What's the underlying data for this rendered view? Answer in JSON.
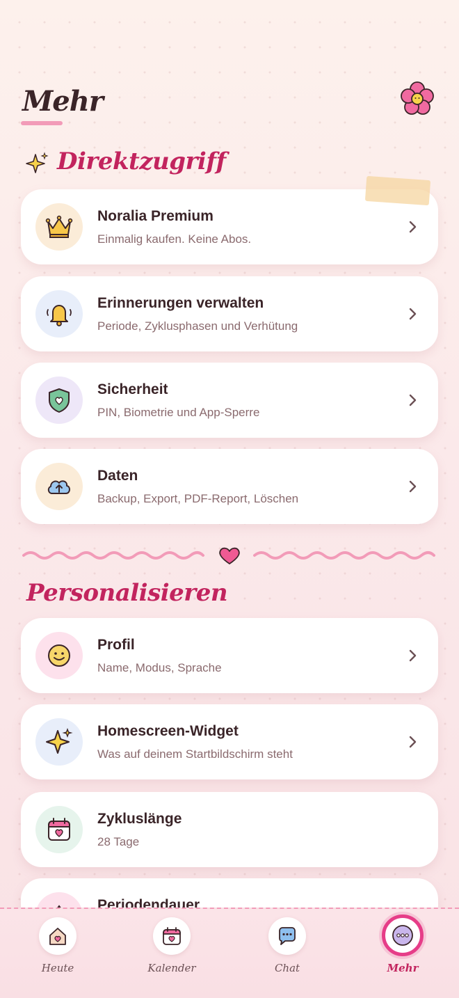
{
  "header": {
    "title": "Mehr"
  },
  "sections": {
    "quick_access": {
      "title": "Direktzugriff"
    },
    "personalize": {
      "title": "Personalisieren"
    }
  },
  "quick_items": [
    {
      "title": "Noralia Premium",
      "subtitle": "Einmalig kaufen. Keine Abos.",
      "icon": "crown-icon"
    },
    {
      "title": "Erinnerungen verwalten",
      "subtitle": "Periode, Zyklusphasen und Verhütung",
      "icon": "bell-icon"
    },
    {
      "title": "Sicherheit",
      "subtitle": "PIN, Biometrie und App-Sperre",
      "icon": "shield-heart-icon"
    },
    {
      "title": "Daten",
      "subtitle": "Backup, Export, PDF-Report, Löschen",
      "icon": "cloud-upload-icon"
    }
  ],
  "personal_items": [
    {
      "title": "Profil",
      "subtitle": "Name, Modus, Sprache",
      "icon": "smiley-icon"
    },
    {
      "title": "Homescreen-Widget",
      "subtitle": "Was auf deinem Startbildschirm steht",
      "icon": "sparkle-icon"
    },
    {
      "title": "Zykluslänge",
      "subtitle": "28 Tage",
      "icon": "calendar-heart-icon"
    },
    {
      "title": "Periodendauer",
      "subtitle": "",
      "icon": "drop-icon"
    }
  ],
  "tabs": [
    {
      "label": "Heute",
      "icon": "house-heart-icon",
      "active": false
    },
    {
      "label": "Kalender",
      "icon": "calendar-icon",
      "active": false
    },
    {
      "label": "Chat",
      "icon": "chat-bubble-icon",
      "active": false
    },
    {
      "label": "Mehr",
      "icon": "more-dots-icon",
      "active": true
    }
  ],
  "colors": {
    "accent": "#c2245e",
    "active_ring": "#e63d88",
    "background": "#fbe9ea"
  }
}
